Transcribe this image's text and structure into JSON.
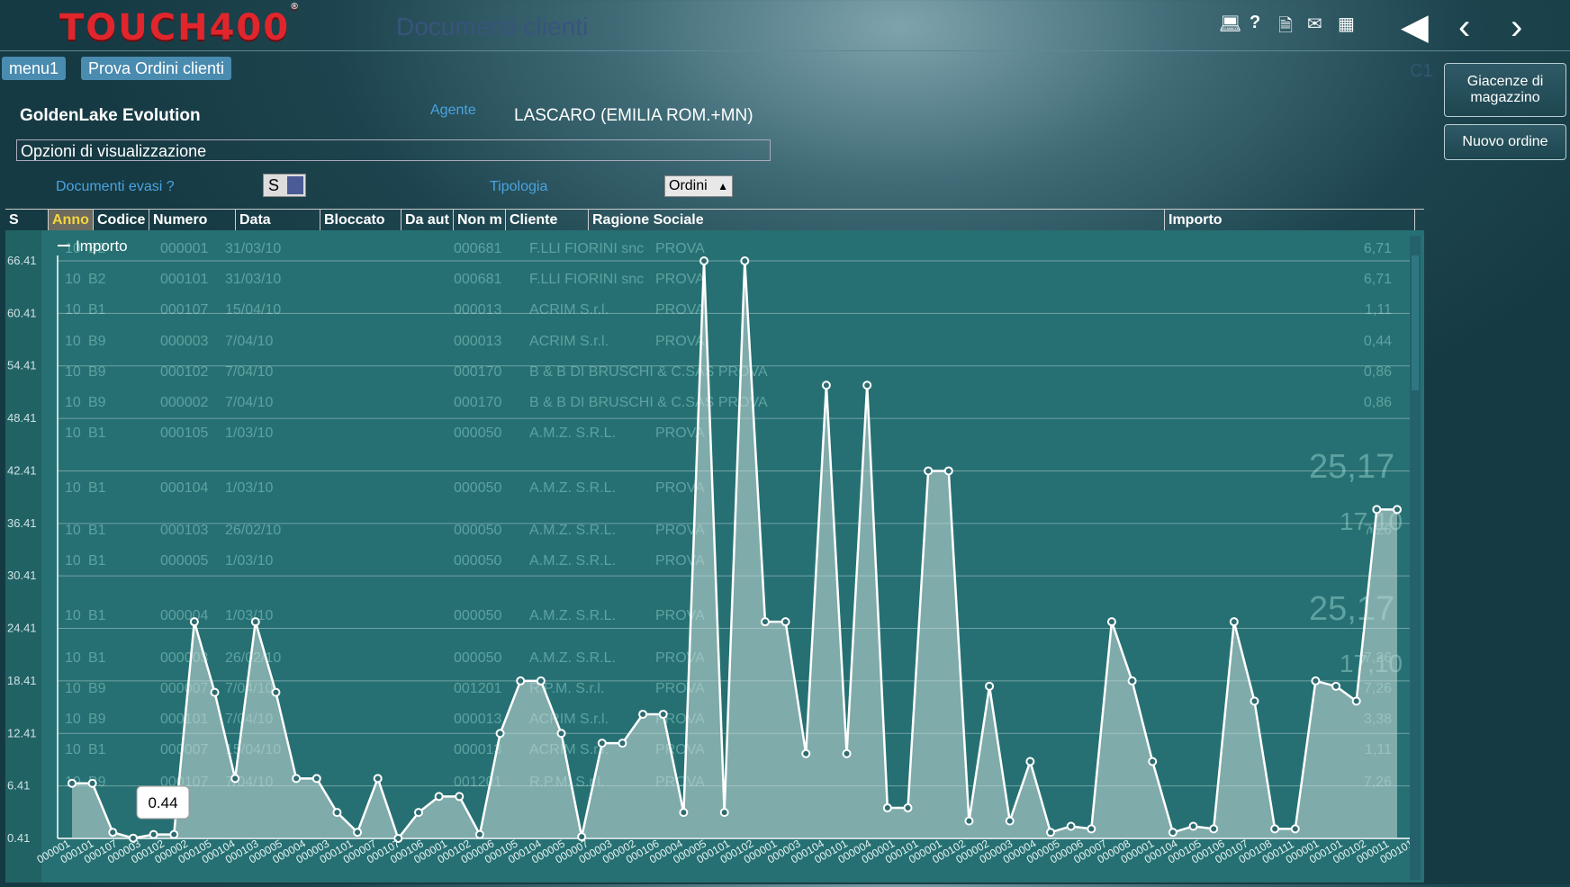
{
  "app": {
    "logo": "TOUCH400",
    "title": "Documenti clienti"
  },
  "header": {
    "icons": [
      "monitor-icon",
      "help-icon",
      "document-icon",
      "mail-icon",
      "grid-icon"
    ],
    "nav": [
      "first-icon",
      "back-icon",
      "forward-icon"
    ],
    "code": "C1"
  },
  "tabs": [
    "menu1",
    "Prova Ordini clienti"
  ],
  "side": {
    "giacenze": "Giacenze di magazzino",
    "nuovo": "Nuovo ordine"
  },
  "form": {
    "company": "GoldenLake Evolution",
    "agente_label": "Agente",
    "agente_value": "LASCARO (EMILIA ROM.+MN)",
    "opzioni": "Opzioni di visualizzazione",
    "evasi_label": "Documenti evasi ?",
    "evasi_value": "S",
    "tipologia_label": "Tipologia",
    "tipologia_value": "Ordini"
  },
  "columns": [
    "S",
    "Anno",
    "Codice",
    "Numero",
    "Data",
    "Bloccato",
    "Da aut",
    "Non m",
    "Cliente",
    "Ragione Sociale",
    "Importo"
  ],
  "rows": [
    [
      "10",
      "B2",
      "000001",
      "31/03/10",
      "000681",
      "F.LLI FIORINI snc",
      "PROVA",
      "6,71"
    ],
    [
      "10",
      "B2",
      "000101",
      "31/03/10",
      "000681",
      "F.LLI FIORINI snc",
      "PROVA",
      "6,71"
    ],
    [
      "10",
      "B1",
      "000107",
      "15/04/10",
      "000013",
      "ACRIM S.r.l.",
      "PROVA",
      "1,11"
    ],
    [
      "10",
      "B9",
      "000003",
      "7/04/10",
      "000013",
      "ACRIM S.r.l.",
      "PROVA",
      "0,44"
    ],
    [
      "10",
      "B9",
      "000102",
      "7/04/10",
      "000170",
      "B & B DI BRUSCHI & C.SAS PROVA",
      "",
      "0,86"
    ],
    [
      "10",
      "B9",
      "000002",
      "7/04/10",
      "000170",
      "B & B DI BRUSCHI & C.SAS PROVA",
      "",
      "0,86"
    ],
    [
      "10",
      "B1",
      "000105",
      "1/03/10",
      "000050",
      "A.M.Z. S.R.L.",
      "PROVA",
      ""
    ],
    [
      "10",
      "B1",
      "000104",
      "1/03/10",
      "000050",
      "A.M.Z. S.R.L.",
      "PROVA",
      ""
    ],
    [
      "10",
      "B1",
      "000103",
      "26/02/10",
      "000050",
      "A.M.Z. S.R.L.",
      "PROVA",
      "7,26"
    ],
    [
      "10",
      "B1",
      "000005",
      "1/03/10",
      "000050",
      "A.M.Z. S.R.L.",
      "PROVA",
      ""
    ],
    [
      "10",
      "B1",
      "000004",
      "1/03/10",
      "000050",
      "A.M.Z. S.R.L.",
      "PROVA",
      ""
    ],
    [
      "10",
      "B1",
      "000003",
      "26/02/10",
      "000050",
      "A.M.Z. S.R.L.",
      "PROVA",
      "7,26"
    ],
    [
      "10",
      "B9",
      "000007",
      "7/04/10",
      "001201",
      "R.P.M. S.r.l.",
      "PROVA",
      "7,26"
    ],
    [
      "10",
      "B9",
      "000101",
      "7/04/10",
      "000013",
      "ACRIM S.r.l.",
      "PROVA",
      "3,38"
    ],
    [
      "10",
      "B1",
      "000007",
      "15/04/10",
      "000013",
      "ACRIM S.r.l.",
      "PROVA",
      "1,11"
    ],
    [
      "10",
      "B9",
      "000107",
      "7/04/10",
      "001201",
      "R.P.M. S.r.l.",
      "PROVA",
      "7,26"
    ]
  ],
  "big_totals": [
    "25,17",
    "17,10",
    "25,17",
    "17,10"
  ],
  "chart_data": {
    "type": "area",
    "legend": "Importo",
    "yticks": [
      "66.41",
      "60.41",
      "54.41",
      "48.41",
      "42.41",
      "36.41",
      "30.41",
      "24.41",
      "18.41",
      "12.41",
      "6.41",
      "0.41"
    ],
    "ylim": [
      0.41,
      66.41
    ],
    "tooltip": "0.44",
    "xlabels": [
      "000001",
      "000101",
      "000107",
      "000003",
      "000102",
      "000002",
      "000105",
      "000104",
      "000103",
      "000005",
      "000004",
      "000003",
      "000101",
      "000007",
      "000107",
      "000106",
      "000001",
      "000102",
      "000006",
      "000105",
      "000104",
      "000005",
      "000007",
      "000003",
      "000002",
      "000106",
      "000004",
      "000005",
      "000101",
      "000102",
      "000001",
      "000003",
      "000104",
      "000101",
      "000004",
      "000001",
      "000101",
      "000001",
      "000102",
      "000002",
      "000003",
      "000004",
      "000005",
      "000006",
      "000007",
      "000008",
      "000001",
      "000104",
      "000105",
      "000106",
      "000107",
      "000108",
      "000111",
      "000001",
      "000101",
      "000102",
      "000011",
      "000101"
    ],
    "values": [
      6.71,
      6.71,
      1.11,
      0.44,
      0.86,
      0.86,
      25.17,
      17.1,
      7.26,
      25.17,
      17.1,
      7.26,
      7.26,
      3.38,
      1.11,
      7.26,
      0.41,
      3.38,
      5.2,
      5.2,
      0.86,
      12.41,
      18.41,
      18.41,
      12.41,
      0.6,
      11.3,
      11.3,
      14.6,
      14.6,
      3.38,
      66.41,
      3.38,
      66.41,
      25.17,
      25.17,
      10.1,
      52.2,
      10.1,
      52.2,
      3.9,
      3.9,
      42.41,
      42.41,
      2.4,
      17.8,
      2.4,
      9.2,
      1.1,
      1.8,
      1.5,
      25.17,
      18.41,
      9.2,
      1.1,
      1.8,
      1.5,
      25.17,
      16.1,
      1.5,
      1.5,
      18.41,
      17.8,
      16.1,
      38.0,
      38.0
    ]
  }
}
